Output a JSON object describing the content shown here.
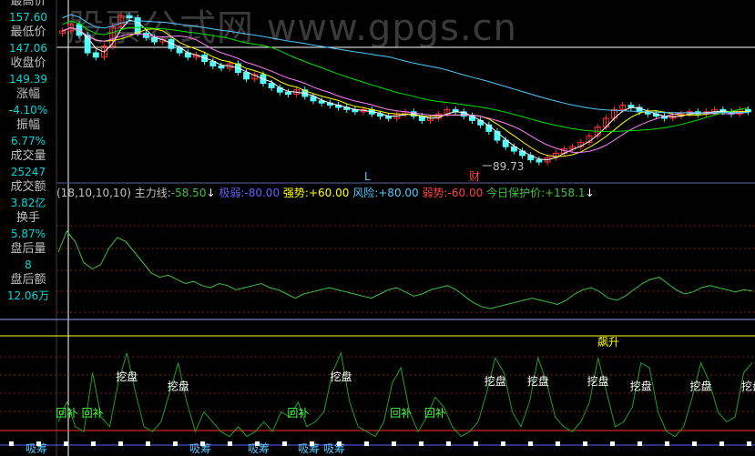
{
  "watermark": "股票公式网 www.gpgs.cn",
  "sidebar": [
    {
      "label": "最高价",
      "value": "157.60"
    },
    {
      "label": "最低价",
      "value": "147.06"
    },
    {
      "label": "收盘价",
      "value": "149.39"
    },
    {
      "label": "涨幅",
      "value": "-4.10%"
    },
    {
      "label": "振幅",
      "value": "6.77%"
    },
    {
      "label": "成交量",
      "value": "25247"
    },
    {
      "label": "成交额",
      "value": "3.82亿"
    },
    {
      "label": "换手",
      "value": "5.87%"
    },
    {
      "label": "盘后量",
      "value": "8"
    },
    {
      "label": "盘后额",
      "value": "12.06万"
    }
  ],
  "price_panel": {
    "marker_L": "L",
    "marker_cai": "财",
    "low_label": "89.73"
  },
  "indicator_header": {
    "params": "(18,10,10,10)",
    "main_label": "主力线:",
    "main_value": "-58.50",
    "main_arrow": "↓",
    "weak_label": "极弱:",
    "weak_value": "-80.00",
    "strong_label": "强势:",
    "strong_value": "+60.00",
    "risk_label": "风险:",
    "risk_value": "+80.00",
    "soft_label": "弱势:",
    "soft_value": "-60.00",
    "protect_label": "今日保护价:",
    "protect_value": "+158.1",
    "protect_arrow": "↓"
  },
  "signal_labels": {
    "dig": "挖盘",
    "fill": "回补",
    "absorb": "吸筹",
    "surge": "飙升"
  },
  "colors": {
    "up": "#ff3232",
    "down": "#54fcfc",
    "ma_white": "#ffffff",
    "ma_yellow": "#ffff00",
    "ma_pink": "#ff80ff",
    "ma_green": "#00e000",
    "ma_blue": "#54c8ff",
    "indicator_line": "#40c040",
    "signal_line": "#20a020"
  },
  "chart_data": [
    {
      "type": "candlestick",
      "title": "",
      "annotations": [
        "L",
        "财",
        "89.73"
      ],
      "ylim": [
        85,
        160
      ],
      "candles_close": [
        150,
        153,
        148,
        140,
        138,
        143,
        152,
        157,
        156,
        149,
        147,
        145,
        146,
        142,
        140,
        138,
        139,
        136,
        134,
        133,
        135,
        131,
        128,
        130,
        126,
        124,
        122,
        121,
        123,
        120,
        118,
        117,
        116,
        115,
        114,
        113,
        114,
        112,
        111,
        110,
        112,
        113,
        111,
        109,
        110,
        112,
        114,
        113,
        111,
        109,
        107,
        104,
        100,
        97,
        95,
        93,
        91,
        90,
        92,
        94,
        96,
        97,
        99,
        102,
        106,
        110,
        114,
        116,
        115,
        113,
        112,
        111,
        110,
        111,
        112,
        113,
        112,
        113,
        114,
        113,
        112,
        114,
        113
      ]
    },
    {
      "type": "line",
      "title": "",
      "series": [
        {
          "name": "主力线",
          "values": [
            -40,
            -30,
            -35,
            -45,
            -48,
            -46,
            -38,
            -33,
            -35,
            -40,
            -45,
            -50,
            -52,
            -51,
            -53,
            -55,
            -54,
            -56,
            -57,
            -55,
            -56,
            -58,
            -57,
            -56,
            -55,
            -57,
            -58,
            -60,
            -62,
            -60,
            -59,
            -58,
            -57,
            -58,
            -59,
            -60,
            -61,
            -62,
            -60,
            -58,
            -57,
            -59,
            -61,
            -60,
            -58,
            -57,
            -56,
            -58,
            -61,
            -64,
            -66,
            -67,
            -66,
            -65,
            -64,
            -63,
            -62,
            -63,
            -64,
            -65,
            -63,
            -60,
            -58,
            -57,
            -59,
            -62,
            -63,
            -61,
            -58,
            -55,
            -53,
            -52,
            -55,
            -58,
            -60,
            -59,
            -57,
            -56,
            -57,
            -58,
            -59,
            -58,
            -58.5
          ]
        }
      ],
      "levels": {
        "极弱": -80,
        "强势": 60,
        "风险": 80,
        "弱势": -60
      }
    },
    {
      "type": "line",
      "title": "",
      "series": [
        {
          "name": "signal",
          "values": [
            20,
            40,
            15,
            10,
            70,
            25,
            15,
            60,
            90,
            50,
            15,
            10,
            20,
            50,
            80,
            40,
            10,
            30,
            20,
            10,
            5,
            15,
            5,
            10,
            20,
            10,
            30,
            25,
            40,
            15,
            20,
            30,
            70,
            90,
            40,
            15,
            10,
            5,
            20,
            60,
            75,
            30,
            10,
            25,
            45,
            35,
            15,
            5,
            10,
            20,
            50,
            85,
            70,
            30,
            15,
            40,
            85,
            60,
            25,
            15,
            10,
            20,
            40,
            85,
            50,
            15,
            20,
            35,
            80,
            75,
            30,
            10,
            5,
            15,
            45,
            80,
            60,
            30,
            20,
            25,
            70,
            80
          ]
        }
      ]
    }
  ]
}
